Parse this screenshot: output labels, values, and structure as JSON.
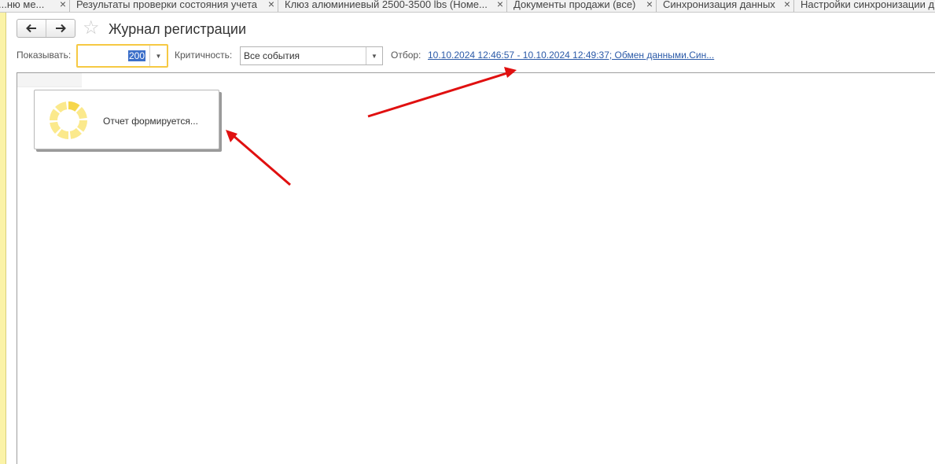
{
  "tabs": [
    {
      "label": "...ню ме...",
      "close": "×"
    },
    {
      "label": "Результаты проверки состояния учета",
      "close": "×"
    },
    {
      "label": "Клюз алюминиевый 2500-3500 lbs (Номе...",
      "close": "×"
    },
    {
      "label": "Документы продажи (все)",
      "close": "×"
    },
    {
      "label": "Синхронизация данных",
      "close": "×"
    },
    {
      "label": "Настройки синхронизации д...",
      "close": ""
    }
  ],
  "header": {
    "back_icon": "arrow-left-icon",
    "forward_icon": "arrow-right-icon",
    "favorite_icon": "star-icon",
    "title": "Журнал регистрации"
  },
  "filters": {
    "show_label": "Показывать:",
    "show_value": "200",
    "criticality_label": "Критичность:",
    "criticality_value": "Все события",
    "selection_label": "Отбор:",
    "selection_link": "10.10.2024 12:46:57 - 10.10.2024 12:49:37; Обмен данными.Син..."
  },
  "report": {
    "status_text": "Отчет формируется...",
    "spinner_icon": "loading-spinner-icon"
  },
  "colors": {
    "accent_yellow": "#f6c943",
    "link_blue": "#2b5aa8",
    "selection_blue": "#3c6fc9",
    "stripe_yellow": "#fbf3a7",
    "arrow_red": "#e01010"
  }
}
